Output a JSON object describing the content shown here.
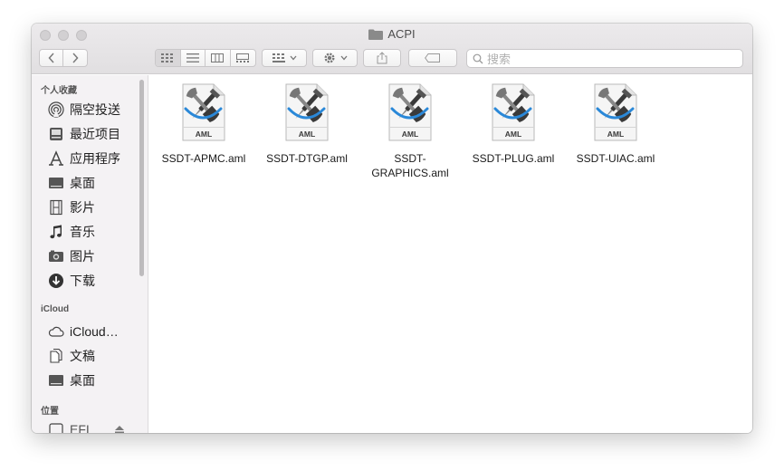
{
  "window": {
    "title": "ACPI"
  },
  "toolbar": {
    "search_placeholder": "搜索",
    "view_modes": [
      "icon-view",
      "list-view",
      "column-view",
      "gallery-view"
    ],
    "active_view": "icon-view"
  },
  "sidebar": {
    "favorites_title": "个人收藏",
    "favorites": [
      {
        "label": "隔空投送",
        "icon": "airdrop-icon"
      },
      {
        "label": "最近项目",
        "icon": "recents-icon"
      },
      {
        "label": "应用程序",
        "icon": "applications-icon"
      },
      {
        "label": "桌面",
        "icon": "desktop-icon"
      },
      {
        "label": "影片",
        "icon": "movies-icon"
      },
      {
        "label": "音乐",
        "icon": "music-icon"
      },
      {
        "label": "图片",
        "icon": "pictures-icon"
      },
      {
        "label": "下载",
        "icon": "downloads-icon"
      }
    ],
    "icloud_title": "iCloud",
    "icloud": [
      {
        "label": "iCloud…",
        "icon": "icloud-icon"
      },
      {
        "label": "文稿",
        "icon": "documents-icon"
      },
      {
        "label": "桌面",
        "icon": "desktop-icon"
      }
    ],
    "locations_title": "位置",
    "locations": [
      {
        "label": "EFI",
        "icon": "disk-icon"
      }
    ]
  },
  "files": [
    {
      "name": "SSDT-APMC.aml",
      "badge": "AML"
    },
    {
      "name": "SSDT-DTGP.aml",
      "badge": "AML"
    },
    {
      "name": "SSDT-\nGRAPHICS.aml",
      "badge": "AML"
    },
    {
      "name": "SSDT-PLUG.aml",
      "badge": "AML"
    },
    {
      "name": "SSDT-UIAC.aml",
      "badge": "AML"
    }
  ]
}
